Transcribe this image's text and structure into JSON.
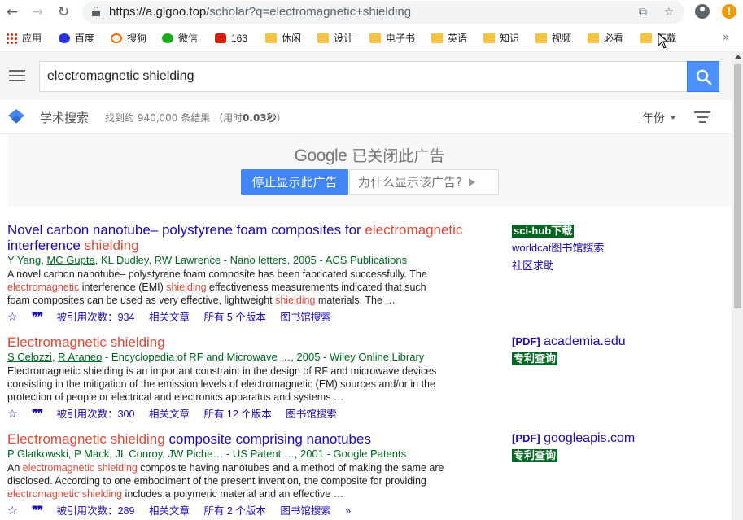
{
  "browser": {
    "url_host": "https://a.glgoo.top",
    "url_path": "/scholar?q=electromagnetic+shielding",
    "bookmarks": [
      "应用",
      "百度",
      "搜狗",
      "微信",
      "163",
      "休闲",
      "设计",
      "电子书",
      "英语",
      "知识",
      "视频",
      "必看",
      "下载"
    ]
  },
  "header": {
    "search_value": "electromagnetic shielding"
  },
  "subbar": {
    "title": "学术搜索",
    "stats_prefix": "找到约 940,000 条结果 （用时",
    "stats_time": "0.03秒",
    "stats_suffix": "）",
    "year_label": "年份"
  },
  "ad": {
    "google_word": "Google",
    "closed_text": "已关闭此广告",
    "stop_label": "停止显示此广告",
    "why_label": "为什么显示该广告?"
  },
  "results": [
    {
      "title_a": "Novel carbon nanotube– polystyrene foam composites for ",
      "title_b": "electromagnetic",
      "title_c": " interference ",
      "title_d": "shielding",
      "author_1": "Y Yang, ",
      "author_2": "MC Gupta",
      "author_3": ", KL Dudley, RW Lawrence - Nano letters, 2005 - ACS Publications",
      "snip_1": "A novel carbon nanotube– polystyrene foam composite has been fabricated successfully. The ",
      "snip_2": "electromagnetic",
      "snip_3": " interference (EMI) ",
      "snip_4": "shielding",
      "snip_5": " effectiveness measurements indicated that such foam composites can be used as very effective, lightweight ",
      "snip_6": "shielding",
      "snip_7": " materials. The …",
      "cited": "被引用次数：934",
      "related": "相关文章",
      "versions": "所有 5 个版本",
      "library": "图书馆搜索",
      "side_badge": "sci-hub下载",
      "side_link_1": "worldcat图书馆搜索",
      "side_link_2": "社区求助"
    },
    {
      "title_a": "Electromagnetic shielding",
      "author_1": "S Celozzi",
      "author_2": ", ",
      "author_3": "R Araneo",
      "author_4": " - Encyclopedia of RF and Microwave …, 2005 - Wiley Online Library",
      "snippet": "Electromagnetic shielding is an important constraint in the design of RF and microwave devices consisting in the mitigation of the emission levels of electromagnetic (EM) sources and/or in the protection of people or electrical and electronics apparatus and systems …",
      "cited": "被引用次数：300",
      "related": "相关文章",
      "versions": "所有 12 个版本",
      "library": "图书馆搜索",
      "side_pdf": "[PDF]",
      "side_domain": "academia.edu",
      "side_badge": "专利查询"
    },
    {
      "title_a": "Electromagnetic shielding",
      "title_b": " composite comprising nanotubes",
      "authors": "P Glatkowski, P Mack, JL Conroy, JW Piche… - US Patent …, 2001 - Google Patents",
      "snip_1": "An ",
      "snip_2": "electromagnetic shielding",
      "snip_3": " composite having nanotubes and a method of making the same are disclosed. According to one embodiment of the present invention, the composite for providing ",
      "snip_4": "electromagnetic shielding",
      "snip_5": " includes a polymeric material and an effective …",
      "cited": "被引用次数：289",
      "related": "相关文章",
      "versions": "所有 2 个版本",
      "library": "图书馆搜索",
      "side_pdf": "[PDF]",
      "side_domain": "googleapis.com",
      "side_badge": "专利查询"
    }
  ],
  "icons": {
    "star": "☆",
    "quote": "❞❞",
    "more": "»",
    "bookmark_more": "»"
  }
}
